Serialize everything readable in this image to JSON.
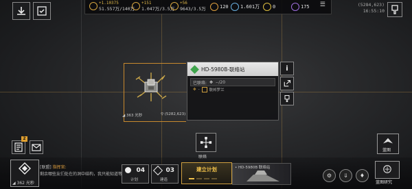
{
  "resources": [
    {
      "rate": "+1.10375",
      "amount": "51.557万/140万",
      "icon": "metal-icon"
    },
    {
      "rate": "+151",
      "amount": "1.047万/3.5万",
      "icon": "crystal-icon"
    },
    {
      "rate": "+56",
      "amount": "9643/3.5万",
      "icon": "gas-icon"
    }
  ],
  "stats": [
    {
      "value": "120",
      "icon": "energy-icon"
    },
    {
      "value": "1.601万",
      "icon": "credit-icon"
    },
    {
      "value": "0",
      "icon": "token-icon"
    },
    {
      "value": "175",
      "icon": "crystal-purple-icon"
    }
  ],
  "header": {
    "coords": "(5284,623)",
    "time": "16:55:10"
  },
  "station": {
    "title": "HD-5980B-联络站",
    "distance": "363 光秒",
    "coords": "(5282,623)",
    "linked_label": "已联络:",
    "linked_value": "--/20",
    "owner": "联邦罗兰"
  },
  "link_button_label": "联络",
  "badge_count": "2",
  "player": {
    "distance": "362 光秒"
  },
  "chat": {
    "channel": "[联盟]",
    "name": "指挥官:",
    "message": "剩余哪些友们处在的洞中结构，我只能知道等待..."
  },
  "counters": [
    {
      "num": "04",
      "label": "计划"
    },
    {
      "num": "03",
      "label": "建造"
    }
  ],
  "plan_label": "建立计划",
  "scene_label": "• HD-5980B 联络站",
  "blueprint_label": "蓝图",
  "blueprint_research_label": "蓝图研究"
}
